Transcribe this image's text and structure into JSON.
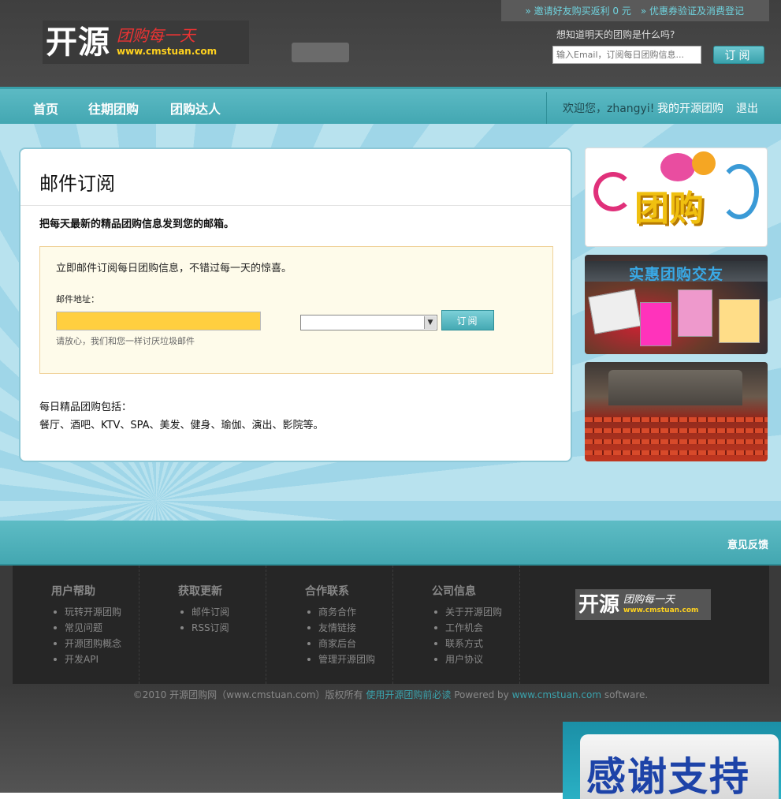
{
  "header": {
    "top_links": [
      "» 邀请好友购买返利 0 元",
      "» 优惠券验证及消费登记"
    ],
    "logo": {
      "main": "开源",
      "slogan": "团购每一天",
      "url": "www.cmstuan.com"
    },
    "subscribe_hint": "想知道明天的团购是什么吗?",
    "subscribe_placeholder": "输入Email，订阅每日团购信息...",
    "subscribe_button": "订阅"
  },
  "nav": {
    "items": [
      "首页",
      "往期团购",
      "团购达人"
    ],
    "welcome": "欢迎您，zhangyi!",
    "my_link": "我的开源团购",
    "logout": "退出"
  },
  "main": {
    "title": "邮件订阅",
    "lead": "把每天最新的精品团购信息发到您的邮箱。",
    "notice_intro": "立即邮件订阅每日团购信息，不错过每一天的惊喜。",
    "email_label": "邮件地址：",
    "email_value": "",
    "city_selected": "",
    "submit": "订阅",
    "spam_note": "请放心，我们和您一样讨厌垃圾邮件",
    "includes_title": "每日精品团购包括：",
    "includes_list": "餐厅、酒吧、KTV、SPA、美发、健身、瑜伽、演出、影院等。"
  },
  "sidebar": {
    "banner1_text": "团购",
    "banner2_text": "实惠团购交友"
  },
  "footer": {
    "feedback": "意见反馈",
    "columns": [
      {
        "title": "用户帮助",
        "items": [
          "玩转开源团购",
          "常见问题",
          "开源团购概念",
          "开发API"
        ]
      },
      {
        "title": "获取更新",
        "items": [
          "邮件订阅",
          "RSS订阅"
        ]
      },
      {
        "title": "合作联系",
        "items": [
          "商务合作",
          "友情链接",
          "商家后台",
          "管理开源团购"
        ]
      },
      {
        "title": "公司信息",
        "items": [
          "关于开源团购",
          "工作机会",
          "联系方式",
          "用户协议"
        ]
      }
    ],
    "logo": {
      "main": "开源",
      "slogan": "团购每一天",
      "url": "www.cmstuan.com"
    },
    "copyright_prefix": "©2010 开源团购网（www.cmstuan.com）版权所有",
    "must_read": "使用开源团购前必读",
    "powered_prefix": "Powered by",
    "powered_link": "www.cmstuan.com",
    "powered_suffix": "software.",
    "thanks": "感谢支持"
  },
  "colors": {
    "accent": "#43a7b2",
    "highlight_input": "#ffcf3f",
    "link": "#6fd3de"
  }
}
